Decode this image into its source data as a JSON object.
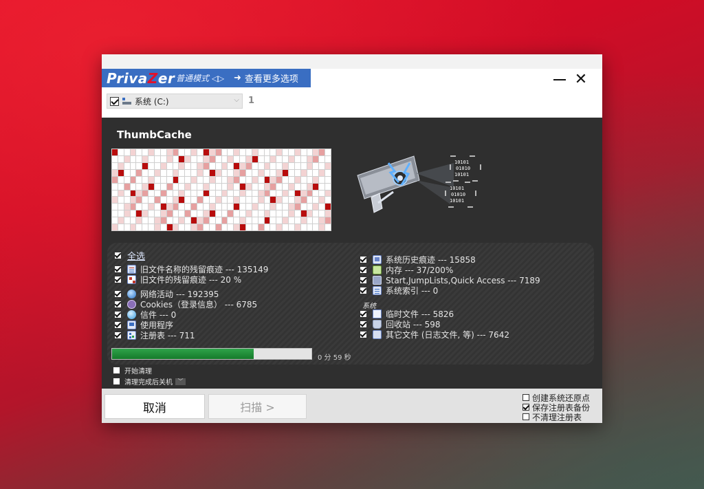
{
  "header": {
    "brand": "PrivaZer",
    "brand_left": "Priva",
    "brand_z": "Z",
    "brand_right": "er",
    "mode": "普通模式 ◁▷",
    "more_options": "查看更多选项",
    "more_arrow": "➜",
    "minimize_icon": "minimize-icon",
    "close_symbol": "✕"
  },
  "drive": {
    "label": "系统 (C:)",
    "checked": true,
    "count": "1"
  },
  "scan": {
    "section_title": "ThumbCache",
    "progress_fraction": 0.71,
    "time_left": "0 分 59 秒"
  },
  "options": {
    "select_all": "全选",
    "left": [
      {
        "label": "旧文件名称的残留痕迹 ---  135149",
        "checked": true,
        "icon": "list-icon"
      },
      {
        "label": "旧文件的残留痕迹 ---  20 %",
        "checked": true,
        "icon": "grid-icon"
      },
      {
        "label": "网络活动 ---  192395",
        "checked": true,
        "icon": "globe-icon"
      },
      {
        "label": "Cookies（登录信息）  --- 6785",
        "checked": true,
        "icon": "cookie-icon"
      },
      {
        "label": "信件 --- 0",
        "checked": true,
        "icon": "mail-icon"
      },
      {
        "label": "使用程序",
        "checked": true,
        "icon": "app-icon"
      },
      {
        "label": "注册表 --- 711",
        "checked": true,
        "icon": "registry-icon"
      }
    ],
    "right": [
      {
        "label": "系统历史痕迹 --- 15858",
        "checked": true,
        "icon": "history-icon"
      },
      {
        "label": "内存 --- 37/200%",
        "checked": true,
        "icon": "memory-icon"
      },
      {
        "label": "Start,JumpLists,Quick Access --- 7189",
        "checked": true,
        "icon": "jumplist-icon"
      },
      {
        "label": "系统索引 --- 0",
        "checked": true,
        "icon": "index-icon"
      },
      {
        "label": "临时文件 --- 5826",
        "checked": true,
        "icon": "file-icon"
      },
      {
        "label": "回收站 --- 598",
        "checked": true,
        "icon": "recycle-bin-icon"
      },
      {
        "label": "其它文件 (日志文件, 等) --- 7642",
        "checked": true,
        "icon": "document-icon"
      }
    ],
    "system_group_label": "系统"
  },
  "after": {
    "start_cleanup": "开始清理",
    "shutdown_after": "清理完成后关机",
    "chevron": "﹀"
  },
  "footer": {
    "cancel": "取消",
    "scan": "扫描 >",
    "restore_point": "创建系统还原点",
    "backup_registry": "保存注册表备份",
    "no_registry_clean": "不清理注册表"
  },
  "colors": {
    "brand_blue": "#3a6ec2",
    "accent_red": "#e3102a",
    "progress_green": "#2fa34a",
    "panel_dark": "#2f2f2f"
  }
}
